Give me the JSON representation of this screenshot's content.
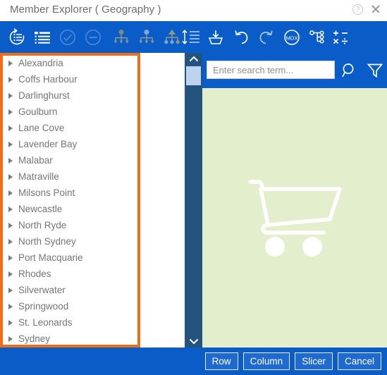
{
  "window": {
    "title": "Member Explorer ( Geography )",
    "help_icon": "help-circle-icon",
    "close_icon": "close-icon",
    "accent_blue": "#0a5cc8",
    "highlight_orange": "#f26c16",
    "panel_green": "#e2eecc"
  },
  "toolbar": {
    "items": [
      {
        "name": "refresh-members-icon",
        "label": "Refresh Members",
        "enabled": true
      },
      {
        "name": "list-members-icon",
        "label": "List Members",
        "enabled": true
      },
      {
        "name": "select-all-icon",
        "label": "Select All",
        "enabled": false
      },
      {
        "name": "deselect-all-icon",
        "label": "Deselect All",
        "enabled": false
      },
      {
        "name": "select-descendants-icon",
        "label": "Select Descendants",
        "enabled": true
      },
      {
        "name": "select-children-icon",
        "label": "Select Children",
        "enabled": true
      },
      {
        "name": "select-leaves-icon",
        "label": "Select Leaves",
        "enabled": true
      },
      {
        "name": "sort-members-icon",
        "label": "Sort Members",
        "enabled": true
      },
      {
        "name": "save-set-icon",
        "label": "Save Set",
        "enabled": true
      },
      {
        "name": "undo-icon",
        "label": "Undo",
        "enabled": true
      },
      {
        "name": "redo-icon",
        "label": "Redo",
        "enabled": true
      },
      {
        "name": "mdx-icon",
        "label": "MDX",
        "enabled": true
      },
      {
        "name": "hierarchy-icon",
        "label": "Hierarchy",
        "enabled": true
      },
      {
        "name": "calculation-icon",
        "label": "Calculation",
        "enabled": true
      }
    ]
  },
  "search": {
    "placeholder": "Enter search term...",
    "value": "",
    "search_icon": "magnifier-icon",
    "filter_icon": "funnel-icon"
  },
  "members": {
    "expand_arrow_icon": "triangle-right-icon",
    "items": [
      {
        "label": "Alexandria"
      },
      {
        "label": "Coffs Harbour"
      },
      {
        "label": "Darlinghurst"
      },
      {
        "label": "Goulburn"
      },
      {
        "label": "Lane Cove"
      },
      {
        "label": "Lavender Bay"
      },
      {
        "label": "Malabar"
      },
      {
        "label": "Matraville"
      },
      {
        "label": "Milsons Point"
      },
      {
        "label": "Newcastle"
      },
      {
        "label": "North Ryde"
      },
      {
        "label": "North Sydney"
      },
      {
        "label": "Port Macquarie"
      },
      {
        "label": "Rhodes"
      },
      {
        "label": "Silverwater"
      },
      {
        "label": "Springwood"
      },
      {
        "label": "St. Leonards"
      },
      {
        "label": "Sydney"
      }
    ]
  },
  "scrollbar": {
    "up_icon": "chevron-up-icon",
    "down_icon": "chevron-down-icon",
    "thumb": "scrollbar-thumb"
  },
  "preview": {
    "icon": "shopping-cart-icon"
  },
  "footer": {
    "buttons": [
      {
        "label": "Row",
        "name": "row-button"
      },
      {
        "label": "Column",
        "name": "column-button"
      },
      {
        "label": "Slicer",
        "name": "slicer-button"
      },
      {
        "label": "Cancel",
        "name": "cancel-button"
      }
    ]
  }
}
